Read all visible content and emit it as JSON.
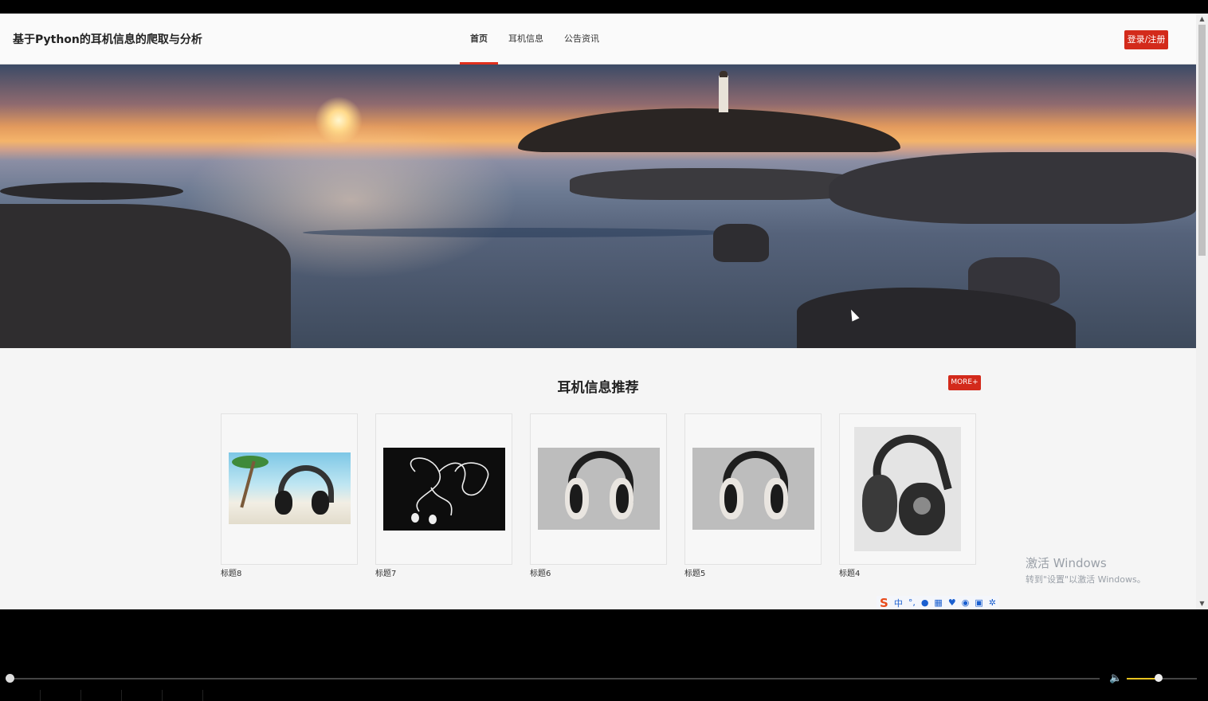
{
  "header": {
    "site_title": "基于Python的耳机信息的爬取与分析",
    "nav": [
      {
        "label": "首页",
        "active": true
      },
      {
        "label": "耳机信息",
        "active": false
      },
      {
        "label": "公告资讯",
        "active": false
      }
    ],
    "login_label": "登录/注册"
  },
  "banner": {
    "slide_count": 3,
    "active_slide": 1
  },
  "recommend": {
    "title": "耳机信息推荐",
    "more_label": "MORE+",
    "items": [
      {
        "caption": "标题8"
      },
      {
        "caption": "标题7"
      },
      {
        "caption": "标题6"
      },
      {
        "caption": "标题5"
      },
      {
        "caption": "标题4"
      }
    ]
  },
  "system_overlay": {
    "activate_title": "激活 Windows",
    "activate_sub": "转到\"设置\"以激活 Windows。",
    "ime_logo": "S",
    "ime_mode": "中"
  },
  "player": {
    "seek_position": 0.0,
    "volume_level": 0.45
  },
  "colors": {
    "accent": "#d32a1b",
    "active_underline": "#e0301e"
  }
}
